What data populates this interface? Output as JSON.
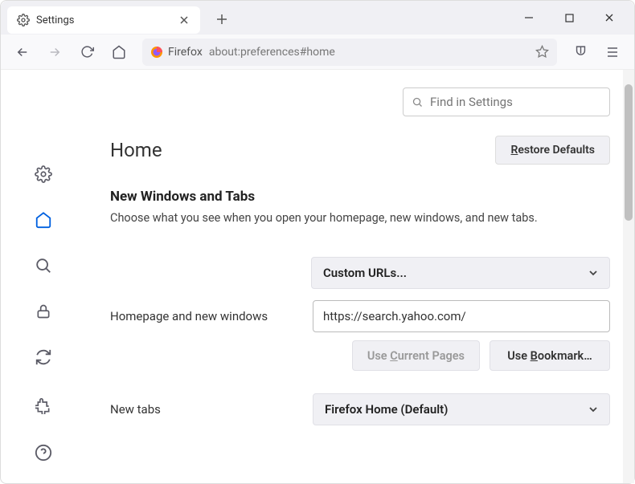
{
  "tab": {
    "title": "Settings"
  },
  "urlbar": {
    "product": "Firefox",
    "address": "about:preferences#home"
  },
  "search": {
    "placeholder": "Find in Settings"
  },
  "page": {
    "title": "Home",
    "restore_label": "Restore Defaults",
    "restore_accesskey": "R"
  },
  "section": {
    "title": "New Windows and Tabs",
    "desc": "Choose what you see when you open your homepage, new windows, and new tabs."
  },
  "homepage": {
    "label": "Homepage and new windows",
    "dropdown_value": "Custom URLs...",
    "url_value": "https://search.yahoo.com/",
    "use_current_label": "Use Current Pages",
    "use_current_accesskey": "C",
    "use_bookmark_label": "Use Bookmark…",
    "use_bookmark_accesskey": "B"
  },
  "newtabs": {
    "label": "New tabs",
    "dropdown_value": "Firefox Home (Default)"
  }
}
